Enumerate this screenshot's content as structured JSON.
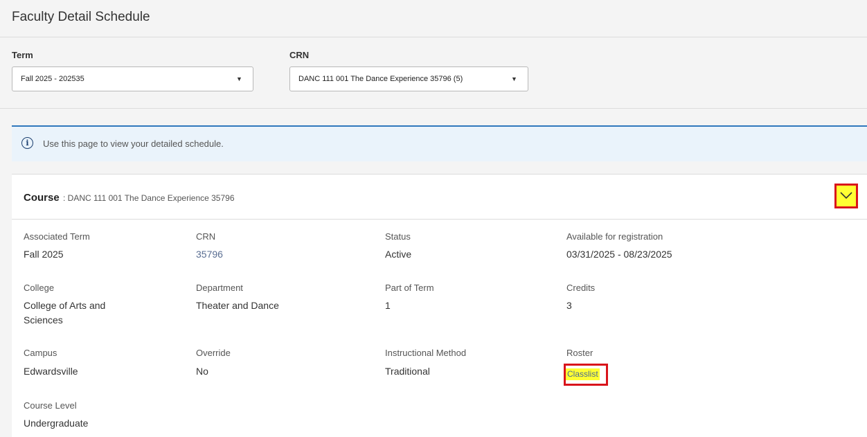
{
  "page": {
    "title": "Faculty Detail Schedule"
  },
  "filters": {
    "term_label": "Term",
    "term_value": "Fall 2025 - 202535",
    "crn_label": "CRN",
    "crn_value": "DANC 111 001 The Dance Experience 35796 (5)"
  },
  "info": {
    "message": "Use this page to view your detailed schedule.",
    "icon": "info-icon"
  },
  "course": {
    "label": "Course",
    "name": ": DANC 111 001 The Dance Experience 35796",
    "toggle_icon": "chevron-down-icon"
  },
  "details": {
    "associated_term": {
      "label": "Associated Term",
      "value": "Fall 2025"
    },
    "crn": {
      "label": "CRN",
      "value": "35796"
    },
    "status": {
      "label": "Status",
      "value": "Active"
    },
    "available": {
      "label": "Available for registration",
      "value": "03/31/2025 - 08/23/2025"
    },
    "college": {
      "label": "College",
      "value_line1": "College of Arts and",
      "value_line2": "Sciences"
    },
    "department": {
      "label": "Department",
      "value": "Theater and Dance"
    },
    "part_of_term": {
      "label": "Part of Term",
      "value": "1"
    },
    "credits": {
      "label": "Credits",
      "value": "3"
    },
    "campus": {
      "label": "Campus",
      "value": "Edwardsville"
    },
    "override": {
      "label": "Override",
      "value": "No"
    },
    "instructional_method": {
      "label": "Instructional Method",
      "value": "Traditional"
    },
    "roster": {
      "label": "Roster",
      "value": "Classlist"
    },
    "course_level": {
      "label": "Course Level",
      "value": "Undergraduate"
    }
  },
  "colors": {
    "highlight": "#ffff33",
    "annotation_border": "#d9141b",
    "banner_accent": "#2f77bc"
  }
}
